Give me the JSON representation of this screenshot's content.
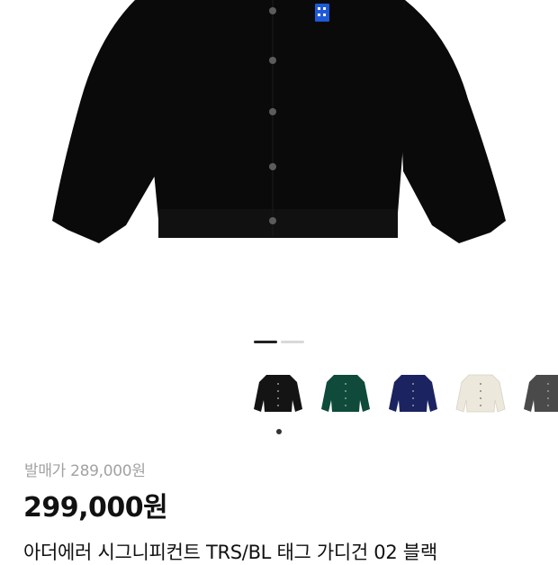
{
  "product": {
    "image_carousel": {
      "total": 2,
      "active_index": 0
    },
    "color_options": [
      {
        "name": "black",
        "color": "#141414"
      },
      {
        "name": "green",
        "color": "#0f4a3a"
      },
      {
        "name": "navy",
        "color": "#1b2460"
      },
      {
        "name": "ivory",
        "color": "#ede8dc"
      },
      {
        "name": "charcoal",
        "color": "#4a4a4a"
      }
    ],
    "selected_color_index": 0,
    "original_price": "발매가 289,000원",
    "price": "299,000원",
    "title": "아더에러 시그니피컨트 TRS/BL 태그 가디건 02 블랙"
  },
  "colors": {
    "garment": "#0a0a0a",
    "button": "#5c5c5c",
    "tag": "#1f5ad6",
    "text_primary": "#111111",
    "text_muted": "#a2a2a2"
  }
}
